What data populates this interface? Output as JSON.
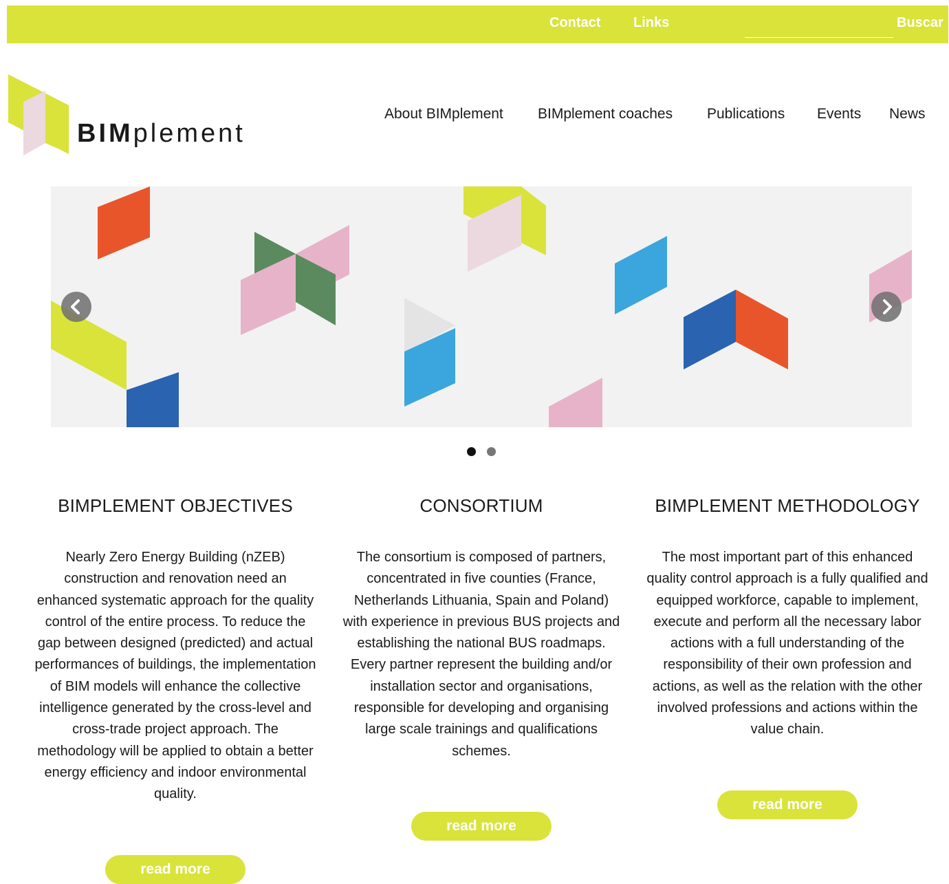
{
  "topbar": {
    "contact": "Contact",
    "links": "Links",
    "search_value": "",
    "search_button": "Buscar"
  },
  "brand": {
    "name_bold": "BIM",
    "name_light": "plement"
  },
  "nav": {
    "items": [
      {
        "label": "About BIMplement"
      },
      {
        "label": "BIMplement coaches"
      },
      {
        "label": "Publications"
      },
      {
        "label": "Events"
      },
      {
        "label": "News"
      }
    ]
  },
  "slider": {
    "active_slide": 1,
    "slide_count": 2
  },
  "sections": [
    {
      "title": "BIMPLEMENT OBJECTIVES",
      "text": "Nearly Zero Energy Building (nZEB) construction and renovation need an enhanced systematic approach for the quality control of the entire process. To reduce the gap between designed (predicted) and actual performances of buildings, the implementation of BIM models will enhance the collective intelligence generated by the cross-level and cross-trade project approach. The methodology will be applied to obtain a better energy efficiency and indoor environmental quality.",
      "button": "read more"
    },
    {
      "title": "CONSORTIUM",
      "text": "The consortium is composed of partners, concentrated in five counties (France, Netherlands Lithuania, Spain and Poland) with experience in previous BUS projects and establishing the national BUS roadmaps. Every partner represent the building and/or installation sector and organisations, responsible for developing and organising large scale trainings and qualifications schemes.",
      "button": "read more"
    },
    {
      "title": "BIMPLEMENT METHODOLOGY",
      "text": "The most important part of this enhanced quality control approach is a fully qualified and equipped workforce, capable to implement, execute and perform all the necessary labor actions with a full understanding of the responsibility of their own profession and actions, as well as the relation with the other involved professions and actions within the value chain.",
      "button": "read more"
    }
  ],
  "colors": {
    "accent": "#d9e33a",
    "orange": "#e8552a",
    "pink": "#e7b3c9",
    "light_pink": "#ecd8df",
    "green": "#5a8a5e",
    "blue": "#2a63b0",
    "light_blue": "#3aa6dd"
  }
}
